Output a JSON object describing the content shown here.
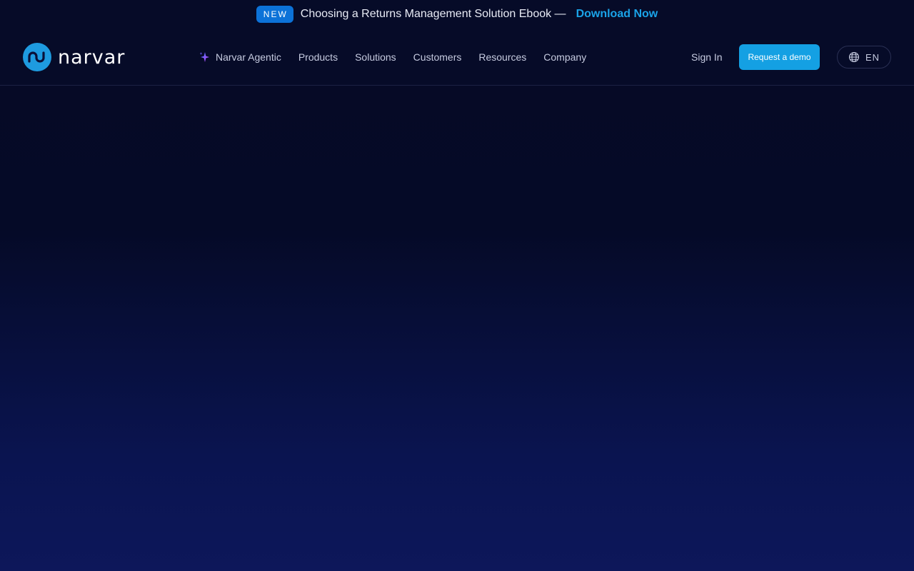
{
  "announcement": {
    "badge": "NEW",
    "text": "Choosing a Returns Management Solution Ebook —",
    "link": "Download Now"
  },
  "header": {
    "logo_text": "narvar",
    "nav": [
      {
        "label": "Narvar Agentic",
        "icon": "sparkle-icon"
      },
      {
        "label": "Products"
      },
      {
        "label": "Solutions"
      },
      {
        "label": "Customers"
      },
      {
        "label": "Resources"
      },
      {
        "label": "Company"
      }
    ],
    "signin": "Sign In",
    "demo": "Request a demo",
    "lang": "EN",
    "lang_icon": "globe-icon"
  },
  "colors": {
    "accent": "#14a0e3",
    "badge": "#0c72d8",
    "background_top": "#060a26",
    "background_bottom": "#0d175a"
  }
}
